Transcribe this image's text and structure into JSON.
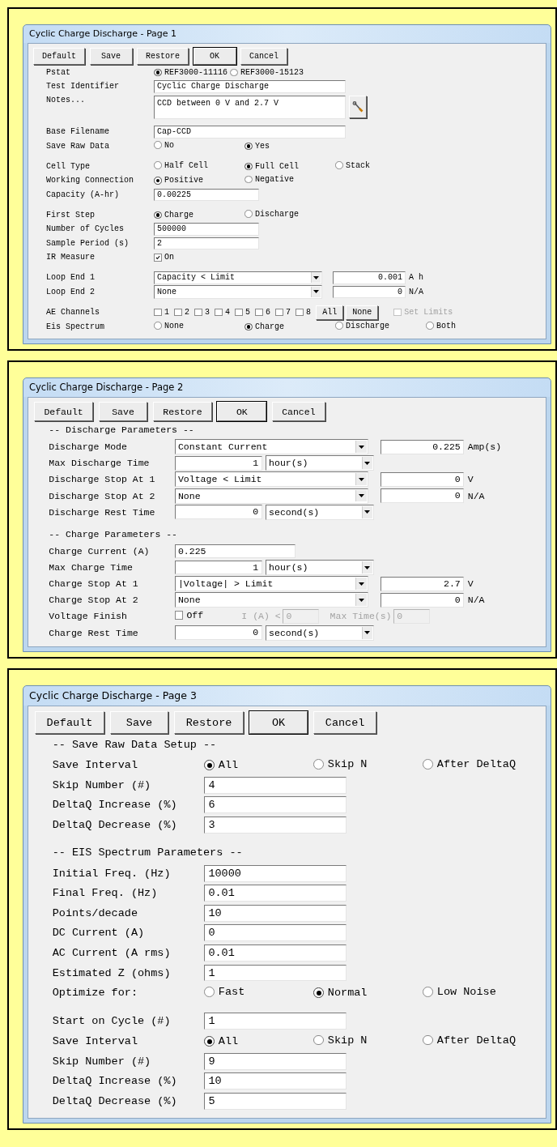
{
  "windows": [
    {
      "title": "Cyclic Charge Discharge - Page 1",
      "buttons": [
        {
          "label": "Default",
          "focused": false
        },
        {
          "label": "Save",
          "focused": false
        },
        {
          "label": "Restore",
          "focused": false
        },
        {
          "label": "OK",
          "focused": true
        },
        {
          "label": "Cancel",
          "focused": false
        }
      ],
      "groups": [
        {
          "rows": [
            {
              "kind": "radio_compact",
              "label": "Pstat",
              "options": [
                {
                  "label": "REF3000-11116",
                  "selected": true
                },
                {
                  "label": "REF3000-15123",
                  "selected": false
                }
              ]
            },
            {
              "kind": "wide_text",
              "label": "Test Identifier",
              "value": "Cyclic Charge Discharge"
            },
            {
              "kind": "notes",
              "label": "Notes...",
              "value": "CCD between 0 V and 2.7 V"
            }
          ]
        },
        {
          "rows": [
            {
              "kind": "wide_text",
              "label": "Base Filename",
              "value": "Cap-CCD"
            },
            {
              "kind": "radio",
              "label": "Save Raw Data",
              "options": [
                {
                  "label": "No",
                  "selected": false
                },
                {
                  "label": "Yes",
                  "selected": true
                }
              ]
            }
          ]
        },
        {
          "rows": [
            {
              "kind": "radio",
              "label": "Cell Type",
              "options": [
                {
                  "label": "Half Cell",
                  "selected": false
                },
                {
                  "label": "Full Cell",
                  "selected": true
                },
                {
                  "label": "Stack",
                  "selected": false
                }
              ]
            },
            {
              "kind": "radio",
              "label": "Working Connection",
              "options": [
                {
                  "label": "Positive",
                  "selected": true
                },
                {
                  "label": "Negative",
                  "selected": false
                }
              ]
            },
            {
              "kind": "text",
              "label": "Capacity (A-hr)",
              "value": "0.00225"
            }
          ]
        },
        {
          "rows": [
            {
              "kind": "radio",
              "label": "First Step",
              "options": [
                {
                  "label": "Charge",
                  "selected": true
                },
                {
                  "label": "Discharge",
                  "selected": false
                }
              ]
            },
            {
              "kind": "text",
              "label": "Number of Cycles",
              "value": "500000"
            },
            {
              "kind": "text",
              "label": "Sample Period (s)",
              "value": "2"
            },
            {
              "kind": "checkbox",
              "label": "IR Measure",
              "option": {
                "label": "On",
                "checked": true
              }
            }
          ]
        },
        {
          "rows": [
            {
              "kind": "select_value",
              "label": "Loop End 1",
              "select": "Capacity < Limit",
              "value": "0.001",
              "unit": "A h"
            },
            {
              "kind": "select_value",
              "label": "Loop End 2",
              "select": "None",
              "value": "0",
              "unit": "N/A"
            }
          ]
        },
        {
          "rows": [
            {
              "kind": "channels",
              "label": "AE Channels",
              "channels": [
                {
                  "label": "1",
                  "checked": false
                },
                {
                  "label": "2",
                  "checked": false
                },
                {
                  "label": "3",
                  "checked": false
                },
                {
                  "label": "4",
                  "checked": false
                },
                {
                  "label": "5",
                  "checked": false
                },
                {
                  "label": "6",
                  "checked": false
                },
                {
                  "label": "7",
                  "checked": false
                },
                {
                  "label": "8",
                  "checked": false
                }
              ],
              "buttons": [
                "All",
                "None"
              ],
              "option": {
                "label": "Set Limits",
                "checked": false,
                "disabled": true
              }
            },
            {
              "kind": "radio",
              "label": "Eis Spectrum",
              "options": [
                {
                  "label": "None",
                  "selected": false
                },
                {
                  "label": "Charge",
                  "selected": true
                },
                {
                  "label": "Discharge",
                  "selected": false
                },
                {
                  "label": "Both",
                  "selected": false
                }
              ]
            }
          ]
        }
      ]
    },
    {
      "title": "Cyclic Charge Discharge - Page 2",
      "buttons": [
        {
          "label": "Default",
          "focused": false
        },
        {
          "label": "Save",
          "focused": false
        },
        {
          "label": "Restore",
          "focused": false
        },
        {
          "label": "OK",
          "focused": true
        },
        {
          "label": "Cancel",
          "focused": false
        }
      ],
      "groups": [
        {
          "heading": "-- Discharge Parameters --",
          "rows": [
            {
              "kind": "select_value",
              "label": "Discharge Mode",
              "select": "Constant Current",
              "value": "0.225",
              "unit": "Amp(s)"
            },
            {
              "kind": "num_unit",
              "label": "Max Discharge Time",
              "value": "1",
              "unit": "hour(s)"
            },
            {
              "kind": "select_value",
              "label": "Discharge Stop At 1",
              "select": "Voltage < Limit",
              "value": "0",
              "unit": "V"
            },
            {
              "kind": "select_value",
              "label": "Discharge Stop At 2",
              "select": "None",
              "value": "0",
              "unit": "N/A"
            },
            {
              "kind": "num_unit",
              "label": "Discharge Rest Time",
              "value": "0",
              "unit": "second(s)"
            }
          ]
        },
        {
          "heading": "-- Charge Parameters --",
          "rows": [
            {
              "kind": "text",
              "label": "Charge Current (A)",
              "value": "0.225"
            },
            {
              "kind": "num_unit",
              "label": "Max Charge Time",
              "value": "1",
              "unit": "hour(s)"
            },
            {
              "kind": "select_value",
              "label": "Charge Stop At 1",
              "select": "|Voltage| > Limit",
              "value": "2.7",
              "unit": "V"
            },
            {
              "kind": "select_value",
              "label": "Charge Stop At 2",
              "select": "None",
              "value": "0",
              "unit": "N/A"
            },
            {
              "kind": "voltage_finish",
              "label": "Voltage Finish",
              "option": {
                "label": "Off",
                "checked": false
              },
              "fields": [
                {
                  "label": "I (A) <",
                  "value": "0",
                  "disabled": true
                },
                {
                  "label": "Max Time(s)",
                  "value": "0",
                  "disabled": true
                }
              ]
            },
            {
              "kind": "num_unit",
              "label": "Charge Rest Time",
              "value": "0",
              "unit": "second(s)"
            }
          ]
        }
      ]
    },
    {
      "title": "Cyclic Charge Discharge - Page 3",
      "buttons": [
        {
          "label": "Default",
          "focused": false
        },
        {
          "label": "Save",
          "focused": false
        },
        {
          "label": "Restore",
          "focused": false
        },
        {
          "label": "OK",
          "focused": true
        },
        {
          "label": "Cancel",
          "focused": false
        }
      ],
      "groups": [
        {
          "heading": "-- Save Raw Data Setup --",
          "rows": [
            {
              "kind": "radio",
              "label": "Save Interval",
              "options": [
                {
                  "label": "All",
                  "selected": true
                },
                {
                  "label": "Skip N",
                  "selected": false
                },
                {
                  "label": "After DeltaQ",
                  "selected": false
                }
              ]
            },
            {
              "kind": "text",
              "label": "Skip Number (#)",
              "value": "4"
            },
            {
              "kind": "text",
              "label": "DeltaQ Increase (%)",
              "value": "6"
            },
            {
              "kind": "text",
              "label": "DeltaQ Decrease (%)",
              "value": "3"
            }
          ]
        },
        {
          "heading": "-- EIS Spectrum Parameters --",
          "rows": [
            {
              "kind": "text",
              "label": "Initial Freq. (Hz)",
              "value": "10000"
            },
            {
              "kind": "text",
              "label": "Final Freq. (Hz)",
              "value": "0.01"
            },
            {
              "kind": "text",
              "label": "Points/decade",
              "value": "10"
            },
            {
              "kind": "text",
              "label": "DC Current (A)",
              "value": "0"
            },
            {
              "kind": "text",
              "label": "AC Current (A rms)",
              "value": "0.01"
            },
            {
              "kind": "text",
              "label": "Estimated Z (ohms)",
              "value": "1"
            },
            {
              "kind": "radio",
              "label": "Optimize for:",
              "options": [
                {
                  "label": "Fast",
                  "selected": false
                },
                {
                  "label": "Normal",
                  "selected": true
                },
                {
                  "label": "Low Noise",
                  "selected": false
                }
              ]
            }
          ]
        },
        {
          "rows": [
            {
              "kind": "text",
              "label": "Start on Cycle (#)",
              "value": "1"
            },
            {
              "kind": "radio",
              "label": "Save Interval",
              "options": [
                {
                  "label": "All",
                  "selected": true
                },
                {
                  "label": "Skip N",
                  "selected": false
                },
                {
                  "label": "After DeltaQ",
                  "selected": false
                }
              ]
            },
            {
              "kind": "text",
              "label": "Skip Number (#)",
              "value": "9"
            },
            {
              "kind": "text",
              "label": "DeltaQ Increase (%)",
              "value": "10"
            },
            {
              "kind": "text",
              "label": "DeltaQ Decrease (%)",
              "value": "5"
            }
          ]
        }
      ]
    }
  ]
}
